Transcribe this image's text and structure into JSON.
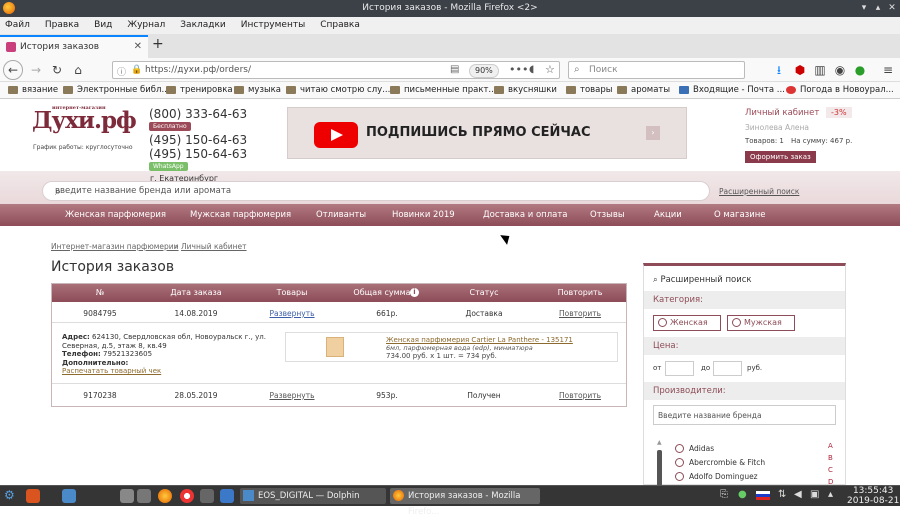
{
  "window": {
    "title": "История заказов - Mozilla Firefox <2>"
  },
  "menu": [
    "Файл",
    "Правка",
    "Вид",
    "Журнал",
    "Закладки",
    "Инструменты",
    "Справка"
  ],
  "tab": {
    "title": "История заказов"
  },
  "url": {
    "value": "https://духи.рф/orders/",
    "zoom": "90%"
  },
  "search": {
    "placeholder": "Поиск"
  },
  "bookmarks": [
    "вязание",
    "Электронные библ...",
    "тренировка",
    "музыка",
    "читаю смотрю слу...",
    "письменные практ...",
    "вкусняшки",
    "товары",
    "ароматы",
    "Входящие - Почта ...",
    "Погода в Новоурал..."
  ],
  "site": {
    "logo": "Духи.рф",
    "logo_small": "интернет-магазин",
    "schedule": "График работы: круглосуточно",
    "phone1": "(800) 333-64-63",
    "free": "Бесплатно",
    "phone2": "(495) 150-64-63",
    "phone3": "(495) 150-64-63",
    "whatsapp": "WhatsApp",
    "city": "г. Екатеринбург",
    "banner": "ПОДПИШИСЬ ПРЯМО СЕЙЧАС",
    "account": "Личный кабинет",
    "discount": "-3%",
    "user": "Зинолева Алена",
    "cart_items": "Товаров: 1",
    "cart_sum": "На сумму: 467 р.",
    "order_button": "Оформить заказ",
    "search_placeholder": "введите название бренда или аромата",
    "advanced": "Расширенный поиск",
    "nav": [
      "Женская парфюмерия",
      "Мужская парфюмерия",
      "Отливанты",
      "Новинки 2019",
      "Доставка и оплата",
      "Отзывы",
      "Акции",
      "О магазине"
    ],
    "crumb1": "Интернет-магазин парфюмерии",
    "crumb_sep": "»",
    "crumb2": "Личный кабинет",
    "page_title": "История заказов"
  },
  "orders": {
    "headers": [
      "№",
      "Дата заказа",
      "Товары",
      "Общая сумма",
      "Статус",
      "Повторить"
    ],
    "rows": [
      {
        "num": "9084795",
        "date": "14.08.2019",
        "items": "Развернуть",
        "sum": "661р.",
        "status": "Доставка",
        "repeat": "Повторить"
      },
      {
        "num": "9170238",
        "date": "28.05.2019",
        "items": "Развернуть",
        "sum": "953р.",
        "status": "Получен",
        "repeat": "Повторить"
      }
    ],
    "detail": {
      "address_label": "Адрес:",
      "address": "624130,  Свердловская обл,  Новоуральск г., ул.",
      "address2": "Северная, д.5, этаж 8, кв.49",
      "phone_label": "Телефон:",
      "phone": "79521323605",
      "extra_label": "Дополнительно:",
      "print": "Распечатать товарный чек",
      "product_title": "Женская парфюмерия Cartier La Panthere - 135171",
      "product_desc": "6мл, парфюмерная вода (edp), миниатюра",
      "product_price": "734.00 руб. х 1 шт. = 734 руб."
    }
  },
  "sidebar": {
    "title": "Расширенный поиск",
    "category": "Категория:",
    "female": "Женская",
    "male": "Мужская",
    "price": "Цена:",
    "from": "от",
    "to": "до",
    "currency": "руб.",
    "producers": "Производители:",
    "brand_placeholder": "Введите название бренда",
    "brands": [
      "Adidas",
      "Abercrombie & Fitch",
      "Adolfo Dominguez"
    ],
    "letters": [
      "A",
      "B",
      "C",
      "D"
    ]
  },
  "taskbar": {
    "dolphin": "EOS_DIGITAL — Dolphin",
    "firefox": "История заказов - Mozilla Firefo...",
    "time": "13:55:43",
    "date": "2019-08-21"
  }
}
